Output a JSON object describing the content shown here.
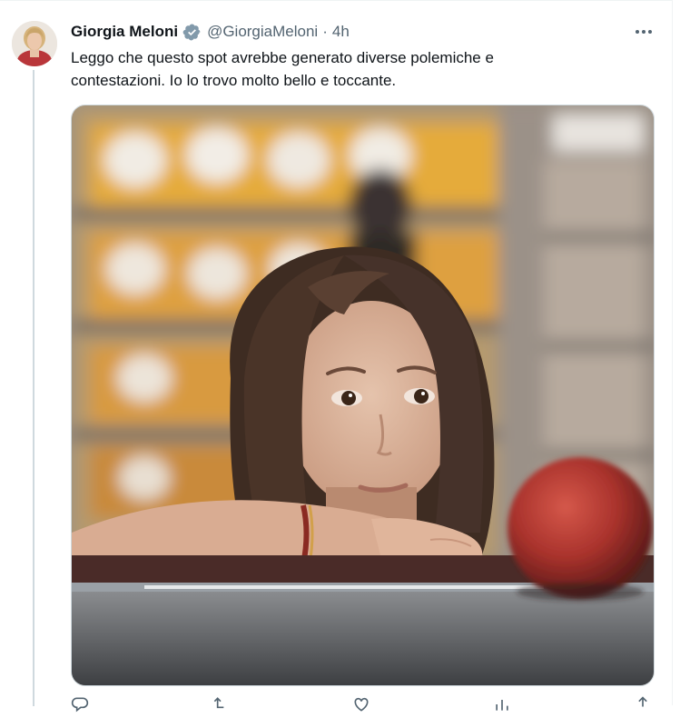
{
  "tweet": {
    "author_name": "Giorgia Meloni",
    "handle": "@GiorgiaMeloni",
    "separator": "·",
    "time": "4h",
    "text_lines": [
      "Leggo che questo spot avrebbe generato diverse polemiche e",
      "contestazioni. Io lo trovo molto bello e toccante."
    ]
  },
  "icons": {
    "verified": "verified-badge-icon",
    "more": "more-options-icon",
    "actions": [
      "reply-icon",
      "retweet-icon",
      "like-icon",
      "views-icon",
      "bookmark-icon",
      "share-icon"
    ]
  },
  "colors": {
    "text_primary": "#0f1419",
    "text_secondary": "#536471",
    "border": "#cfd9de",
    "verified_badge": "#829aab"
  }
}
